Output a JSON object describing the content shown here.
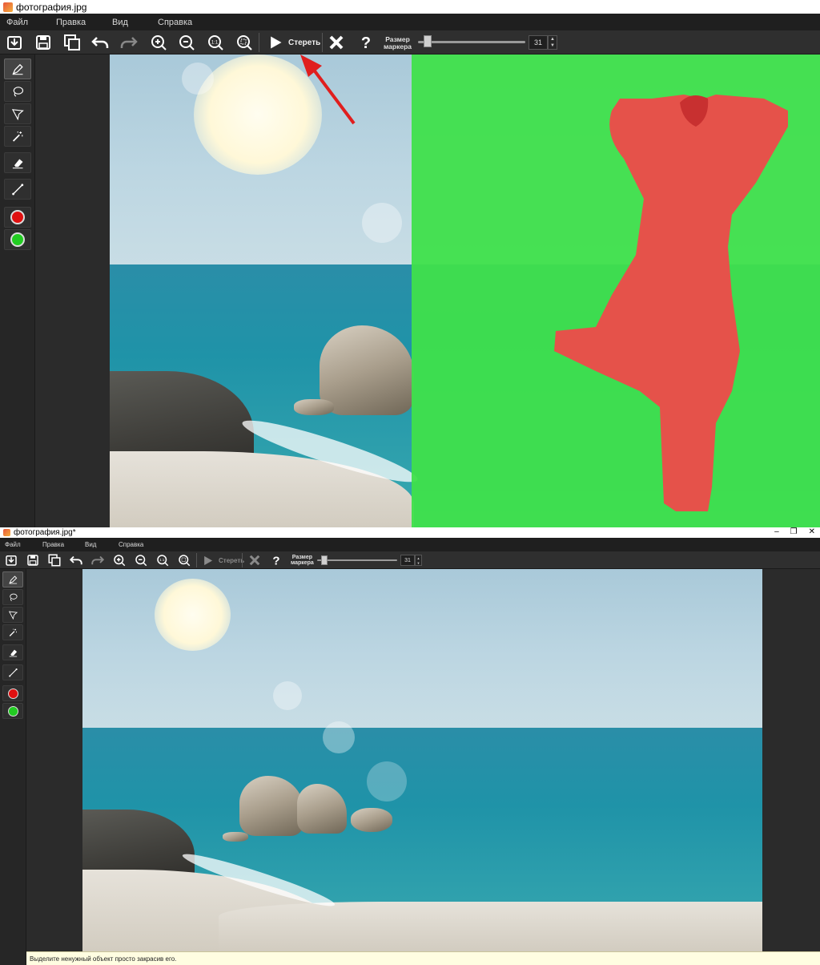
{
  "top_window": {
    "title": "фотография.jpg",
    "menu": [
      "Файл",
      "Правка",
      "Вид",
      "Справка"
    ],
    "erase_label": "Стереть",
    "marker_size_label_line1": "Размер",
    "marker_size_label_line2": "маркера",
    "marker_size_value": "31",
    "marker_slider_level": 0.05,
    "marker_color_red": "#e01010",
    "marker_color_green": "#22cc22",
    "mask_green": "#3fe04b",
    "mask_red": "#ee4a4a",
    "arrow_color": "#e01e1e"
  },
  "bottom_window": {
    "title": "фотография.jpg*",
    "menu": [
      "Файл",
      "Правка",
      "Вид",
      "Справка"
    ],
    "erase_label": "Стереть",
    "marker_size_label_line1": "Размер",
    "marker_size_label_line2": "маркера",
    "marker_size_value": "31",
    "marker_slider_level": 0.05,
    "status_text": "Выделите ненужный объект просто закрасив его.",
    "window_controls": [
      "–",
      "❐",
      "✕"
    ]
  },
  "icons": {
    "toolbar": [
      "open-icon",
      "save-icon",
      "save-as-icon",
      "undo-icon",
      "redo-icon",
      "zoom-in-icon",
      "zoom-out-icon",
      "zoom-actual-icon",
      "zoom-fit-icon",
      "play-icon",
      "cancel-icon",
      "help-icon"
    ],
    "sidebar": [
      "marker-icon",
      "lasso-icon",
      "polygon-lasso-icon",
      "magic-wand-icon",
      "eraser-icon",
      "line-icon",
      "red-marker-icon",
      "green-marker-icon"
    ]
  }
}
